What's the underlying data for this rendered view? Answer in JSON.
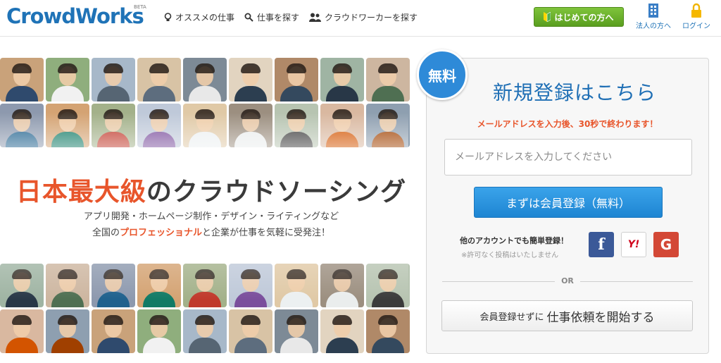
{
  "header": {
    "logo_text": "CrowdWorks",
    "logo_badge": "BETA",
    "nav": [
      {
        "label": "オススメの仕事",
        "icon": "lightbulb-icon"
      },
      {
        "label": "仕事を探す",
        "icon": "search-icon"
      },
      {
        "label": "クラウドワーカーを探す",
        "icon": "people-icon"
      }
    ],
    "start_button": "はじめての方へ",
    "corporate_link": "法人の方へ",
    "login_link": "ログイン"
  },
  "hero": {
    "headline_accent": "日本最大級",
    "headline_rest": "のクラウドソーシング",
    "sub_line1": "アプリ開発・ホームページ制作・デザイン・ライティングなど",
    "sub_line2_prefix": "全国の",
    "sub_line2_accent": "プロフェッショナル",
    "sub_line2_suffix": "と企業が仕事を気軽に受発注！"
  },
  "register": {
    "badge": "無料",
    "title": "新規登録はこちら",
    "note": "メールアドレスを入力後、30秒で終わります！",
    "email_placeholder": "メールアドレスを入力してください",
    "submit": "まずは会員登録（無料）",
    "social_label": "他のアカウントでも簡単登録！",
    "social_note": "※許可なく投稿はいたしません",
    "social": {
      "facebook": "f",
      "yahoo": "Y!",
      "google": "G"
    },
    "or": "OR",
    "alt_small": "会員登録せずに",
    "alt_big": "仕事依頼を開始する"
  },
  "colors": {
    "brand": "#1f73b7",
    "accent": "#e8552b",
    "green_button": "#6cb52e",
    "blue_button": "#2b94df"
  }
}
